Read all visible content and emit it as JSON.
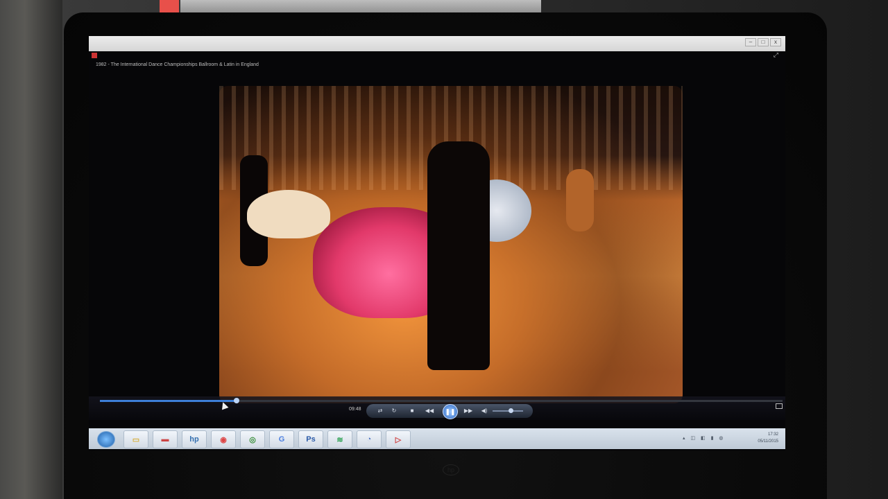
{
  "window": {
    "title": "1982 - The International Dance Championships Ballroom & Latin in England",
    "minimize": "–",
    "maximize": "□",
    "close": "x"
  },
  "player": {
    "time": "09:48",
    "progress_fraction": 0.2,
    "volume_fraction": 0.6,
    "buttons": {
      "shuffle": "⇄",
      "repeat": "↻",
      "stop": "■",
      "prev": "◀◀",
      "play_pause": "❚❚",
      "next": "▶▶",
      "mute": "◀)"
    }
  },
  "taskbar": {
    "items": [
      {
        "name": "folder",
        "glyph": "▭",
        "color": "#d8b040"
      },
      {
        "name": "app",
        "glyph": "▬",
        "color": "#c44"
      },
      {
        "name": "hp",
        "glyph": "hp",
        "color": "#3570b0"
      },
      {
        "name": "chrome-alt",
        "glyph": "◉",
        "color": "#d44"
      },
      {
        "name": "chrome",
        "glyph": "◎",
        "color": "#3a8f3a"
      },
      {
        "name": "google",
        "glyph": "G",
        "color": "#4a7ee0"
      },
      {
        "name": "photoshop",
        "glyph": "Ps",
        "color": "#2a5aa8"
      },
      {
        "name": "spotify",
        "glyph": "≋",
        "color": "#2aa050"
      },
      {
        "name": "network",
        "glyph": "◔",
        "color": "#4a70c0"
      },
      {
        "name": "media-player",
        "glyph": "▷",
        "color": "#d04040"
      }
    ],
    "clock_time": "17:32",
    "clock_date": "05/11/2015",
    "tray": "▴ ◫ ◧ ▮ ◍"
  },
  "brand": "hp"
}
